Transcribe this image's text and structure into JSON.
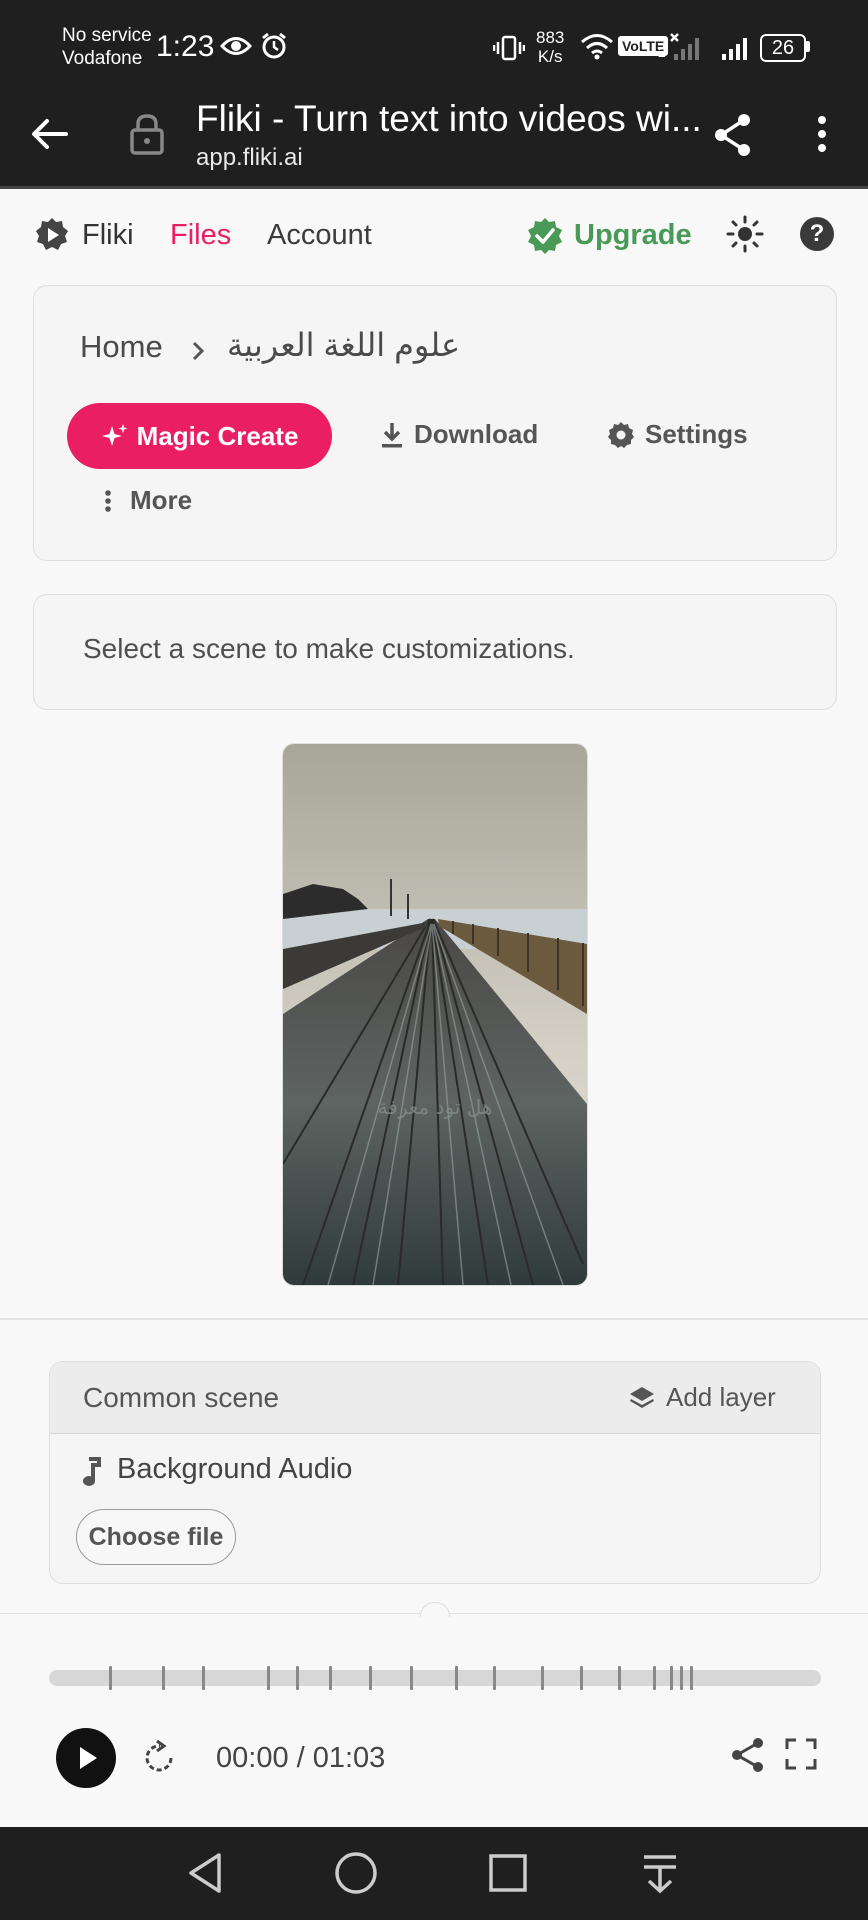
{
  "status_bar": {
    "carrier_line1": "No service",
    "carrier_line2": "Vodafone",
    "time": "1:23",
    "net_speed_value": "883",
    "net_speed_unit": "K/s",
    "volte_label": "VoLTE",
    "sim_index": "2",
    "battery": "26"
  },
  "browser": {
    "title": "Fliki - Turn text into videos wi...",
    "url": "app.fliki.ai"
  },
  "nav": {
    "brand": "Fliki",
    "files": "Files",
    "account": "Account",
    "upgrade": "Upgrade",
    "accent_color": "#e91e63",
    "upgrade_color": "#4a9a57"
  },
  "breadcrumb": {
    "home": "Home",
    "current": "علوم اللغة العربية"
  },
  "toolbar": {
    "magic_create": "Magic Create",
    "download": "Download",
    "settings": "Settings",
    "more": "More"
  },
  "notice": {
    "text": "Select a scene to make customizations."
  },
  "preview": {
    "caption": "هل تود معرفة"
  },
  "scene_panel": {
    "title": "Common scene",
    "add_layer": "Add layer",
    "background_audio": "Background Audio",
    "choose_file": "Choose file"
  },
  "player": {
    "time": "00:00 / 01:03",
    "progress_fraction": 0
  }
}
